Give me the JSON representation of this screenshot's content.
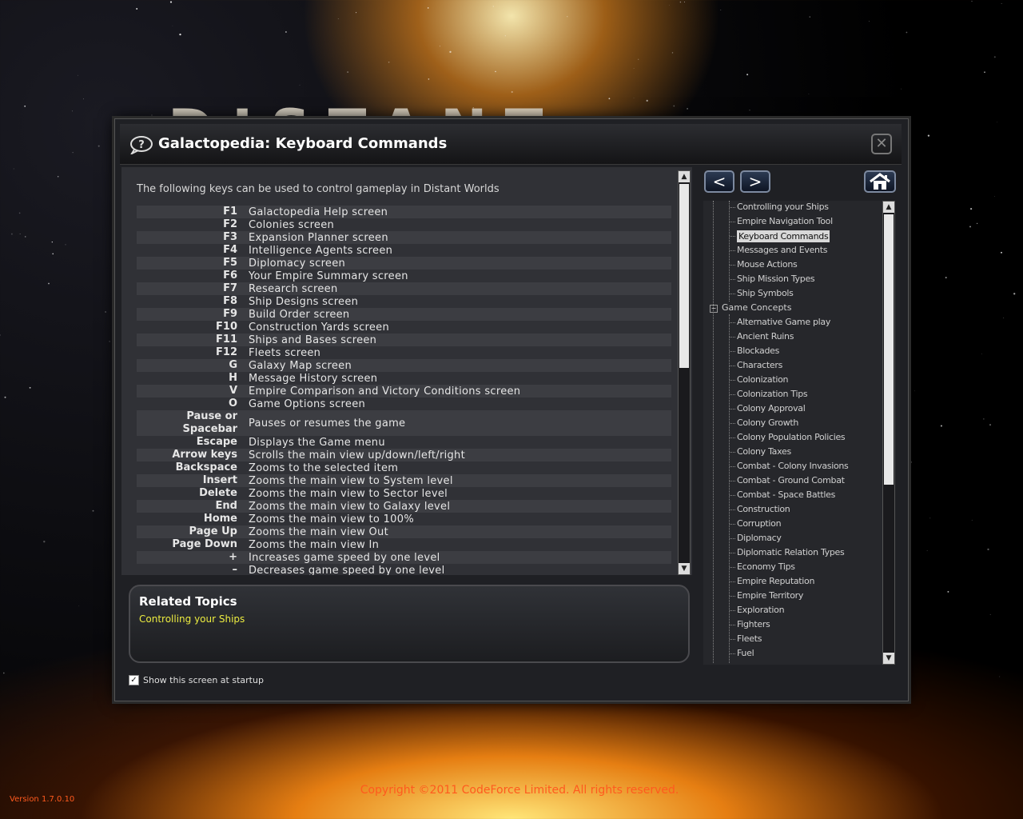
{
  "background": {
    "game_title": "DISTANT WORLDS",
    "version": "Version 1.7.0.10",
    "copyright": "Copyright ©2011 CodeForce Limited. All rights reserved."
  },
  "window": {
    "title": "Galactopedia: Keyboard Commands",
    "close_glyph": "✕"
  },
  "content": {
    "intro": "The following keys can be used to control gameplay in Distant Worlds",
    "keys": [
      {
        "key": "F1",
        "desc": "Galactopedia Help screen"
      },
      {
        "key": "F2",
        "desc": "Colonies screen"
      },
      {
        "key": "F3",
        "desc": "Expansion Planner screen"
      },
      {
        "key": "F4",
        "desc": "Intelligence Agents screen"
      },
      {
        "key": "F5",
        "desc": "Diplomacy screen"
      },
      {
        "key": "F6",
        "desc": "Your Empire Summary screen"
      },
      {
        "key": "F7",
        "desc": "Research screen"
      },
      {
        "key": "F8",
        "desc": "Ship Designs screen"
      },
      {
        "key": "F9",
        "desc": "Build Order screen"
      },
      {
        "key": "F10",
        "desc": "Construction Yards screen"
      },
      {
        "key": "F11",
        "desc": "Ships and Bases screen"
      },
      {
        "key": "F12",
        "desc": "Fleets screen"
      },
      {
        "key": "G",
        "desc": "Galaxy Map screen"
      },
      {
        "key": "H",
        "desc": "Message History screen"
      },
      {
        "key": "V",
        "desc": "Empire Comparison and Victory Conditions screen"
      },
      {
        "key": "O",
        "desc": "Game Options screen"
      },
      {
        "key": "Pause or Spacebar",
        "desc": "Pauses or resumes the game"
      },
      {
        "key": "Escape",
        "desc": "Displays the Game menu"
      },
      {
        "key": "Arrow keys",
        "desc": "Scrolls the main view up/down/left/right"
      },
      {
        "key": "Backspace",
        "desc": "Zooms to the selected item"
      },
      {
        "key": "Insert",
        "desc": "Zooms the main view to System level"
      },
      {
        "key": "Delete",
        "desc": "Zooms the main view to Sector level"
      },
      {
        "key": "End",
        "desc": "Zooms the main view to Galaxy level"
      },
      {
        "key": "Home",
        "desc": "Zooms the main view to 100%"
      },
      {
        "key": "Page Up",
        "desc": "Zooms the main view Out"
      },
      {
        "key": "Page Down",
        "desc": "Zooms the main view In"
      },
      {
        "key": "+",
        "desc": "Increases game speed by one level"
      },
      {
        "key": "–",
        "desc": "Decreases game speed by one level"
      }
    ]
  },
  "related": {
    "title": "Related Topics",
    "link": "Controlling your Ships"
  },
  "startup": {
    "label": "Show this screen at startup",
    "checked": true
  },
  "nav": {
    "back_glyph": "<",
    "forward_glyph": ">"
  },
  "tree": {
    "top_items": [
      "Controlling your Ships",
      "Empire Navigation Tool",
      "Keyboard Commands",
      "Messages and Events",
      "Mouse Actions",
      "Ship Mission Types",
      "Ship Symbols"
    ],
    "selected": "Keyboard Commands",
    "group": "Game Concepts",
    "group_items": [
      "Alternative Game play",
      "Ancient Ruins",
      "Blockades",
      "Characters",
      "Colonization",
      "Colonization Tips",
      "Colony Approval",
      "Colony Growth",
      "Colony Population Policies",
      "Colony Taxes",
      "Combat - Colony Invasions",
      "Combat - Ground Combat",
      "Combat - Space Battles",
      "Construction",
      "Corruption",
      "Diplomacy",
      "Diplomatic Relation Types",
      "Economy Tips",
      "Empire Reputation",
      "Empire Territory",
      "Exploration",
      "Fighters",
      "Fleets",
      "Fuel"
    ]
  },
  "colors": {
    "accent_link": "#ecec40",
    "copyright": "#ff5a1e",
    "panel": "#303136"
  }
}
